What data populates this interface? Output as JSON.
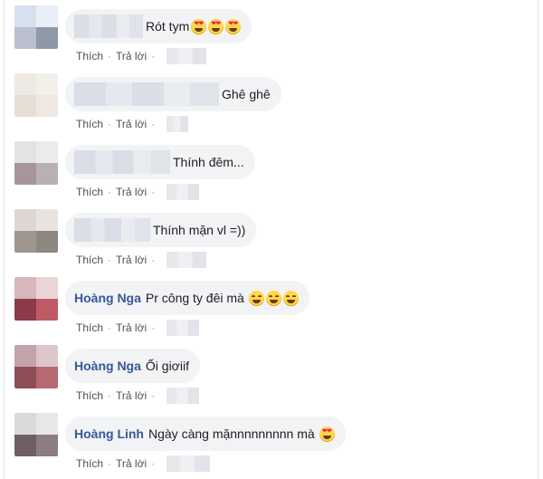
{
  "actions": {
    "like": "Thích",
    "separator": "·",
    "reply": "Trả lời"
  },
  "comments": [
    {
      "name": "",
      "text": "Rót tym",
      "emojis": [
        "smiling-face-with-heart-eyes",
        "smiling-face-with-heart-eyes",
        "smiling-face-with-heart-eyes"
      ],
      "avatar_colors": [
        "#d6e0f0",
        "#e9eef6",
        "#b9c1cf",
        "#8e98a8"
      ]
    },
    {
      "name": "",
      "text": "Ghê ghê",
      "emojis": [],
      "avatar_colors": [
        "#efe9e4",
        "#f3efeb",
        "#e6ddd4",
        "#efe8e1"
      ]
    },
    {
      "name": "",
      "text": "Thính đêm...",
      "emojis": [],
      "avatar_colors": [
        "#e3e3e5",
        "#eceaeb",
        "#a8959c",
        "#b9b0b5"
      ]
    },
    {
      "name": "",
      "text": "Thính mặn vl =))",
      "emojis": [],
      "avatar_colors": [
        "#ddd6d1",
        "#e8e3df",
        "#9e968f",
        "#8d8782"
      ]
    },
    {
      "name": "Hoàng Nga",
      "text": "Pr công ty đêi mà",
      "emojis": [
        "grinning-squinting-face",
        "grinning-squinting-face",
        "grinning-squinting-face"
      ],
      "avatar_colors": [
        "#d7b6bc",
        "#e9d4d6",
        "#8d3b48",
        "#c05a66"
      ]
    },
    {
      "name": "Hoàng Nga",
      "text": "Ối giơiif",
      "emojis": [],
      "avatar_colors": [
        "#c4a3aa",
        "#ddc6c9",
        "#8f4d57",
        "#b76871"
      ]
    },
    {
      "name": "Hoàng Linh",
      "text": "Ngày càng mặnnnnnnnnn mà",
      "emojis": [
        "smiling-face-with-heart-eyes"
      ],
      "avatar_colors": [
        "#dcd9dc",
        "#e9e6e8",
        "#6f5f64",
        "#8c7d81"
      ]
    }
  ]
}
